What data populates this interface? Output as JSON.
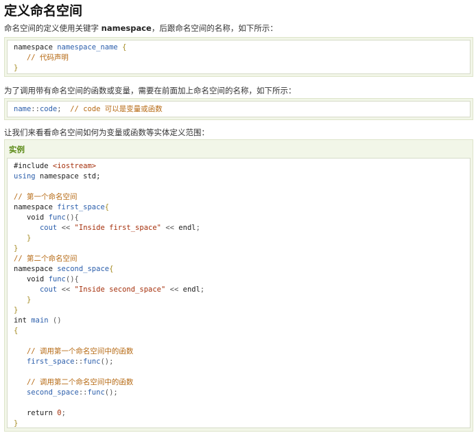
{
  "page": {
    "title": "定义命名空间",
    "intro": {
      "before": "命名空间的定义使用关键字 ",
      "keyword": "namespace",
      "after": "，后跟命名空间的名称，如下所示："
    },
    "code1": {
      "l1_kw": "namespace",
      "l1_name": "namespace_name",
      "l1_brace": "{",
      "l2_comment": "// 代码声明",
      "l3_brace": "}"
    },
    "para2": "为了调用带有命名空间的函数或变量，需要在前面加上命名空间的名称，如下所示：",
    "code2": {
      "ns": "name",
      "sep": "::",
      "member": "code",
      "semi": ";",
      "comment": "// code 可以是变量或函数"
    },
    "para3": "让我们来看看命名空间如何为变量或函数等实体定义范围：",
    "example": {
      "title": "实例",
      "include_kw": "#include ",
      "include_file": "<iostream>",
      "using_kw": "using",
      "using_rest": " namespace std;",
      "cm_first": "// 第一个命名空间",
      "ns1_kw": "namespace",
      "ns1_name": "first_space",
      "void1": "void",
      "func1": "func",
      "cout1": "cout",
      "op_shl": "<<",
      "str1": "\"Inside first_space\"",
      "endl": "endl",
      "cm_second": "// 第二个命名空间",
      "ns2_kw": "namespace",
      "ns2_name": "second_space",
      "str2": "\"Inside second_space\"",
      "int_kw": "int",
      "main": "main",
      "cm_call1": "// 调用第一个命名空间中的函数",
      "call1_ns": "first_space",
      "call_sep": "::",
      "call_func": "func",
      "cm_call2": "// 调用第二个命名空间中的函数",
      "call2_ns": "second_space",
      "return_kw": "return",
      "zero": "0"
    }
  }
}
